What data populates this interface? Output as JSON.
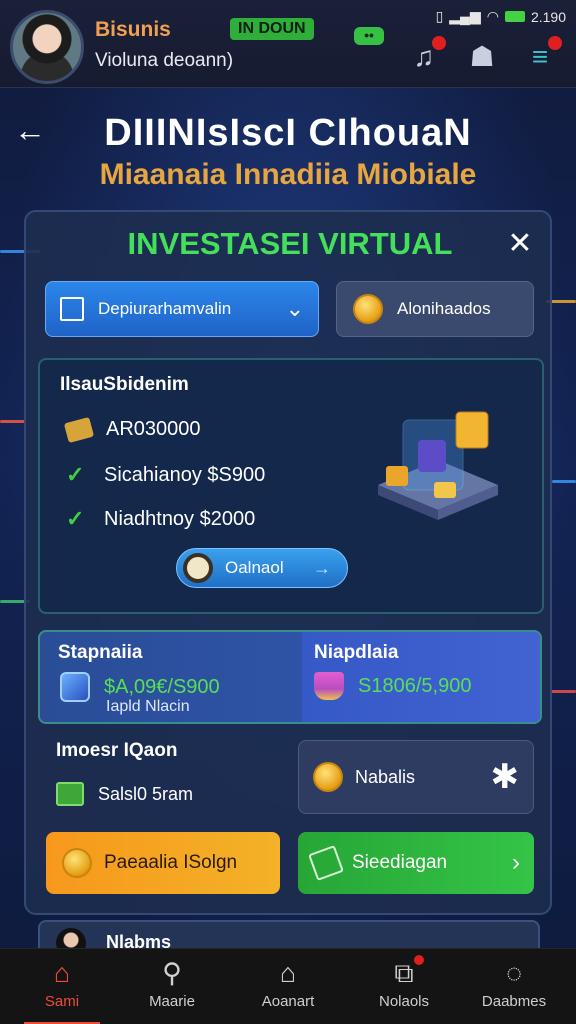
{
  "colors": {
    "accent_green": "#44e05a",
    "accent_orange": "#e8a640",
    "nav_active": "#f04a3a",
    "primary_blue": "#2c86ea"
  },
  "status_bar": {
    "time": "2.190"
  },
  "header": {
    "user_name": "Bisunis",
    "user_subtitle": "Violuna deoann)",
    "badge": "IN DOUN",
    "chat_icon": "chat-bubble-icon",
    "icons": [
      "music-notif-icon",
      "ghost-icon",
      "menu-icon"
    ]
  },
  "page": {
    "title": "DIIINIsIscI CIhouaN",
    "subtitle": "Miaanaia Innadiia Miobiale"
  },
  "panel": {
    "title": "INVESTASEI VIRTUAL",
    "select_label": "Depiurarhamvalin",
    "alt_button_label": "Alonihaados",
    "info": {
      "heading": "IlsauSbidenim",
      "rows": [
        {
          "icon": "wallet-icon",
          "text": "AR030000"
        },
        {
          "icon": "check-icon",
          "text": "Sicahianoу $S900"
        },
        {
          "icon": "check-icon",
          "text": "Niadhtnoy $2000"
        }
      ],
      "pill_label": "Oalnaol"
    },
    "split": {
      "left_label": "Stapnaiia",
      "left_value": "$А,09€/Ѕ900",
      "left_sub": "Iapld Nlacin",
      "right_label": "Niapdlaia",
      "right_value": "S1806/5,900"
    },
    "section": {
      "label": "Imoesr IQaon",
      "row_text": "Salsl0 5ram"
    },
    "nabalis_label": "Nabalis",
    "orange_button": "Paeaalia ISolgn",
    "green_button": "Sieediagan",
    "peek_label": "Nlabms"
  },
  "nav": [
    {
      "label": "Sami",
      "icon": "home-icon",
      "active": true
    },
    {
      "label": "Maarie",
      "icon": "search-person-icon",
      "active": false
    },
    {
      "label": "Aoanart",
      "icon": "house-icon",
      "active": false
    },
    {
      "label": "Nolaols",
      "icon": "notification-icon",
      "active": false
    },
    {
      "label": "Daabmes",
      "icon": "chat-icon",
      "active": false
    }
  ]
}
